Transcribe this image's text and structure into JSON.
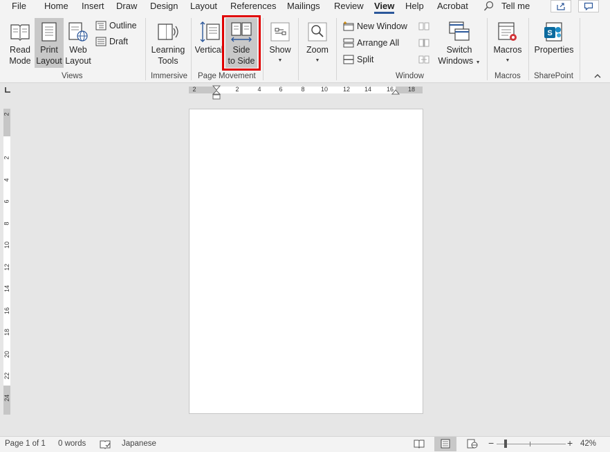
{
  "tabs": [
    {
      "label": "File"
    },
    {
      "label": "Home"
    },
    {
      "label": "Insert"
    },
    {
      "label": "Draw"
    },
    {
      "label": "Design"
    },
    {
      "label": "Layout"
    },
    {
      "label": "References"
    },
    {
      "label": "Mailings"
    },
    {
      "label": "Review"
    },
    {
      "label": "View"
    },
    {
      "label": "Help"
    },
    {
      "label": "Acrobat"
    }
  ],
  "active_tab": "View",
  "tell_me": "Tell me",
  "ribbon": {
    "views": {
      "read_mode": [
        "Read",
        "Mode"
      ],
      "print_layout": [
        "Print",
        "Layout"
      ],
      "web_layout": [
        "Web",
        "Layout"
      ],
      "outline": "Outline",
      "draft": "Draft",
      "group": "Views"
    },
    "immersive": {
      "learning_tools": [
        "Learning",
        "Tools"
      ],
      "group": "Immersive"
    },
    "page_movement": {
      "vertical": "Vertical",
      "side_to_side": [
        "Side",
        "to Side"
      ],
      "group": "Page Movement"
    },
    "show": {
      "label": "Show"
    },
    "zoom": {
      "label": "Zoom"
    },
    "window": {
      "new_window": "New Window",
      "arrange_all": "Arrange All",
      "split": "Split",
      "switch_windows": [
        "Switch",
        "Windows"
      ],
      "group": "Window"
    },
    "macros": {
      "label": "Macros",
      "group": "Macros"
    },
    "sharepoint": {
      "properties": "Properties",
      "group": "SharePoint"
    }
  },
  "ruler_h": [
    "2",
    "2",
    "4",
    "6",
    "8",
    "10",
    "12",
    "14",
    "16",
    "18"
  ],
  "ruler_v": [
    "2",
    "2",
    "4",
    "6",
    "8",
    "10",
    "12",
    "14",
    "16",
    "18",
    "20",
    "22",
    "24"
  ],
  "status": {
    "page": "Page 1 of 1",
    "words": "0 words",
    "language": "Japanese",
    "zoom_level": "42%"
  },
  "colors": {
    "accent": "#2b579a",
    "highlight": "#e00000"
  }
}
